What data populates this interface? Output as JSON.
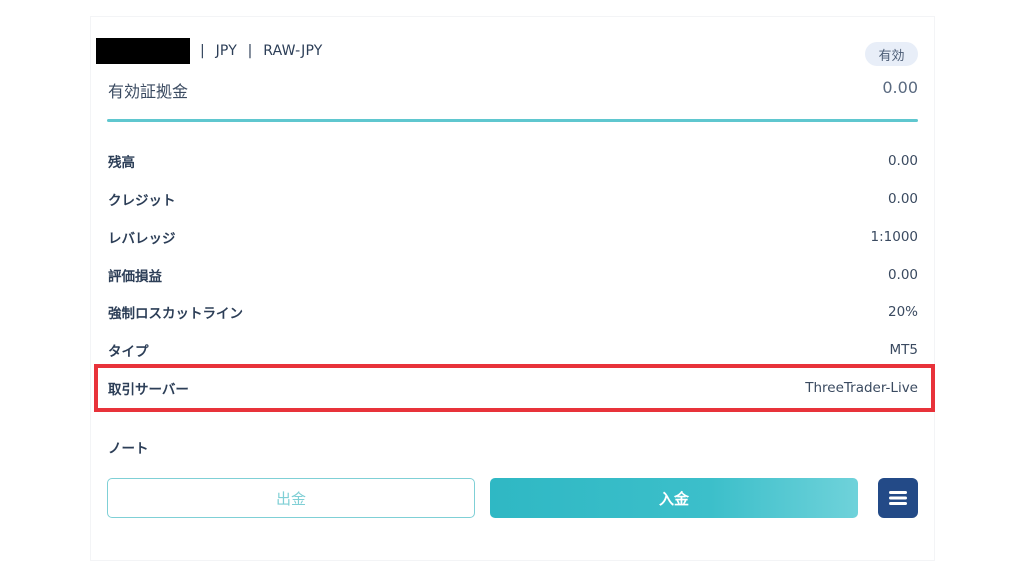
{
  "account": {
    "currency": "JPY",
    "group": "RAW-JPY",
    "separator": "|",
    "status": "有効"
  },
  "equity": {
    "label": "有効証拠金",
    "value": "0.00"
  },
  "details": [
    {
      "label": "残高",
      "value": "0.00"
    },
    {
      "label": "クレジット",
      "value": "0.00"
    },
    {
      "label": "レバレッジ",
      "value": "1:1000"
    },
    {
      "label": "評価損益",
      "value": "0.00"
    },
    {
      "label": "強制ロスカットライン",
      "value": "20%"
    },
    {
      "label": "タイプ",
      "value": "MT5"
    },
    {
      "label": "取引サーバー",
      "value": "ThreeTrader-Live"
    }
  ],
  "notes_label": "ノート",
  "buttons": {
    "withdraw": "出金",
    "deposit": "入金",
    "menu_icon": "hamburger-menu-icon"
  },
  "colors": {
    "accent_teal": "#5fc7cf",
    "deposit_button": "#2fb8c4",
    "menu_button": "#234a87",
    "highlight_box": "#e8323a",
    "status_badge_bg": "#e8eef8"
  }
}
